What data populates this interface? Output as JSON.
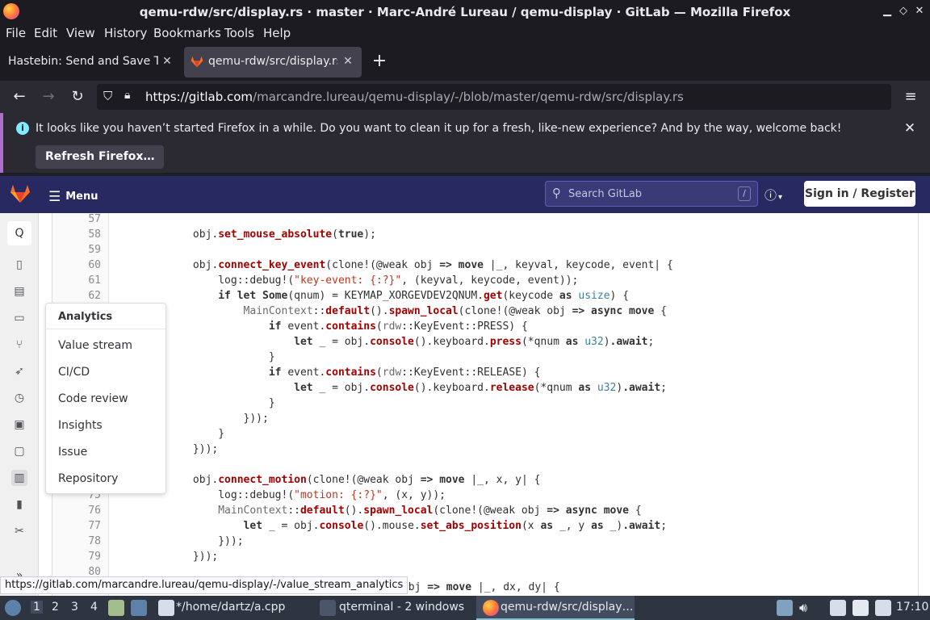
{
  "window": {
    "title": "qemu-rdw/src/display.rs · master · Marc-André Lureau / qemu-display · GitLab — Mozilla Firefox"
  },
  "menubar": [
    "File",
    "Edit",
    "View",
    "History",
    "Bookmarks",
    "Tools",
    "Help"
  ],
  "tabs": [
    {
      "label": "Hastebin: Send and Save Te"
    },
    {
      "label": "qemu-rdw/src/display.rs"
    }
  ],
  "nav": {
    "url_host": "https://gitlab.com",
    "url_path": "/marcandre.lureau/qemu-display/-/blob/master/qemu-rdw/src/display.rs"
  },
  "notice": {
    "text": "It looks like you haven’t started Firefox in a while. Do you want to clean it up for a fresh, like-new experience? And by the way, welcome back!",
    "button": "Refresh Firefox…"
  },
  "gitlab": {
    "menu_label": "Menu",
    "search_placeholder": "Search GitLab",
    "search_shortcut": "/",
    "signin": "Sign in / Register",
    "sidebar_top": "Q"
  },
  "flyout": {
    "title": "Analytics",
    "items": [
      "Value stream",
      "CI/CD",
      "Code review",
      "Insights",
      "Issue",
      "Repository"
    ]
  },
  "code": {
    "line_numbers": [
      "57",
      "58",
      "59",
      "60",
      "61",
      "62",
      "",
      "",
      "",
      "",
      "",
      "",
      "",
      "",
      "",
      "",
      "",
      "",
      "",
      "75",
      "76",
      "77",
      "78",
      "79",
      "80"
    ],
    "lines": [
      "",
      "            obj.set_mouse_absolute(true);",
      "",
      "            obj.connect_key_event(clone!(@weak obj => move |_, keyval, keycode, event| {",
      "                log::debug!(\"key-event: {:?}\", (keyval, keycode, event));",
      "                if let Some(qnum) = KEYMAP_XORGEVDEV2QNUM.get(keycode as usize) {",
      "                    MainContext::default().spawn_local(clone!(@weak obj => async move {",
      "                        if event.contains(rdw::KeyEvent::PRESS) {",
      "                            let _ = obj.console().keyboard.press(*qnum as u32).await;",
      "                        }",
      "                        if event.contains(rdw::KeyEvent::RELEASE) {",
      "                            let _ = obj.console().keyboard.release(*qnum as u32).await;",
      "                        }",
      "                    }));",
      "                }",
      "            }));",
      "",
      "            obj.connect_motion(clone!(@weak obj => move |_, x, y| {",
      "                log::debug!(\"motion: {:?}\", (x, y));",
      "                MainContext::default().spawn_local(clone!(@weak obj => async move {",
      "                    let _ = obj.console().mouse.set_abs_position(x as _, y as _).await;",
      "                }));",
      "            }));",
      "",
      "@weak obj => move |_, dx, dy| {"
    ]
  },
  "statusbar": {
    "link": "https://gitlab.com/marcandre.lureau/qemu-display/-/value_stream_analytics"
  },
  "taskbar": {
    "workspaces": [
      "1",
      "2",
      "3",
      "4"
    ],
    "apps": [
      "*/home/dartz/a.cpp",
      "qterminal - 2 windows",
      "qemu-rdw/src/display…"
    ],
    "clock": "17:10"
  }
}
